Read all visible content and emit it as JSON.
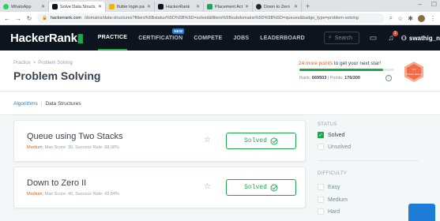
{
  "browser": {
    "tabs": [
      {
        "title": "WhatsApp",
        "color": "#25d366",
        "active": false
      },
      {
        "title": "Solve Data Structures",
        "color": "#0e141e",
        "active": true
      },
      {
        "title": "flutter login page code",
        "color": "#f4b400",
        "active": false
      },
      {
        "title": "HackerRank",
        "color": "#0e141e",
        "active": false
      },
      {
        "title": "Placement Activity Wor",
        "color": "#1aa260",
        "active": false
      },
      {
        "title": "Down to Zero II - chert",
        "color": "#24292e",
        "active": false
      }
    ],
    "address": {
      "host": "hackerrank.com",
      "path": "/domains/data-structures?filters%5Bstatus%5D%5B%5D=solved&filters%5Bsubdomains%5D%5B%5D=queues&badge_type=problem-solving"
    }
  },
  "nav": {
    "logo_main": "HackerRank",
    "links": [
      {
        "label": "PRACTICE",
        "active": true
      },
      {
        "label": "CERTIFICATION",
        "badge": "NEW"
      },
      {
        "label": "COMPETE"
      },
      {
        "label": "JOBS"
      },
      {
        "label": "LEADERBOARD"
      }
    ],
    "search_placeholder": "Search",
    "notification_count": "1",
    "username": "swathig_n"
  },
  "header": {
    "breadcrumb": [
      "Practice",
      "Problem Solving"
    ],
    "title": "Problem Solving",
    "star_msg_points": "24 more points",
    "star_msg_rest": " to get your next star!",
    "progress": 0.88,
    "rank_label": "Rank: ",
    "rank_value": "669503",
    "points_label": "Points: ",
    "points_value": "176/200",
    "badge_label": "Problem Solving"
  },
  "subnav": {
    "link": "Algorithms",
    "current": "Data Structures"
  },
  "challenges": [
    {
      "name": "Queue using Two Stacks",
      "difficulty": "Medium",
      "meta": ", Max Score: 30, Success Rate: 88.08%",
      "status": "Solved"
    },
    {
      "name": "Down to Zero II",
      "difficulty": "Medium",
      "meta": ", Max Score: 40, Success Rate: 43.84%",
      "status": "Solved"
    }
  ],
  "filters": {
    "status_title": "STATUS",
    "status": [
      {
        "label": "Solved",
        "checked": true
      },
      {
        "label": "Unsolved",
        "checked": false
      }
    ],
    "difficulty_title": "DIFFICULTY",
    "difficulty": [
      {
        "label": "Easy",
        "checked": false
      },
      {
        "label": "Medium",
        "checked": false
      },
      {
        "label": "Hard",
        "checked": false
      }
    ]
  },
  "colors": {
    "brand_green": "#1ba94c",
    "nav_bg": "#0e141e",
    "accent_orange": "#e95d11",
    "link_blue": "#1f7ec1"
  }
}
